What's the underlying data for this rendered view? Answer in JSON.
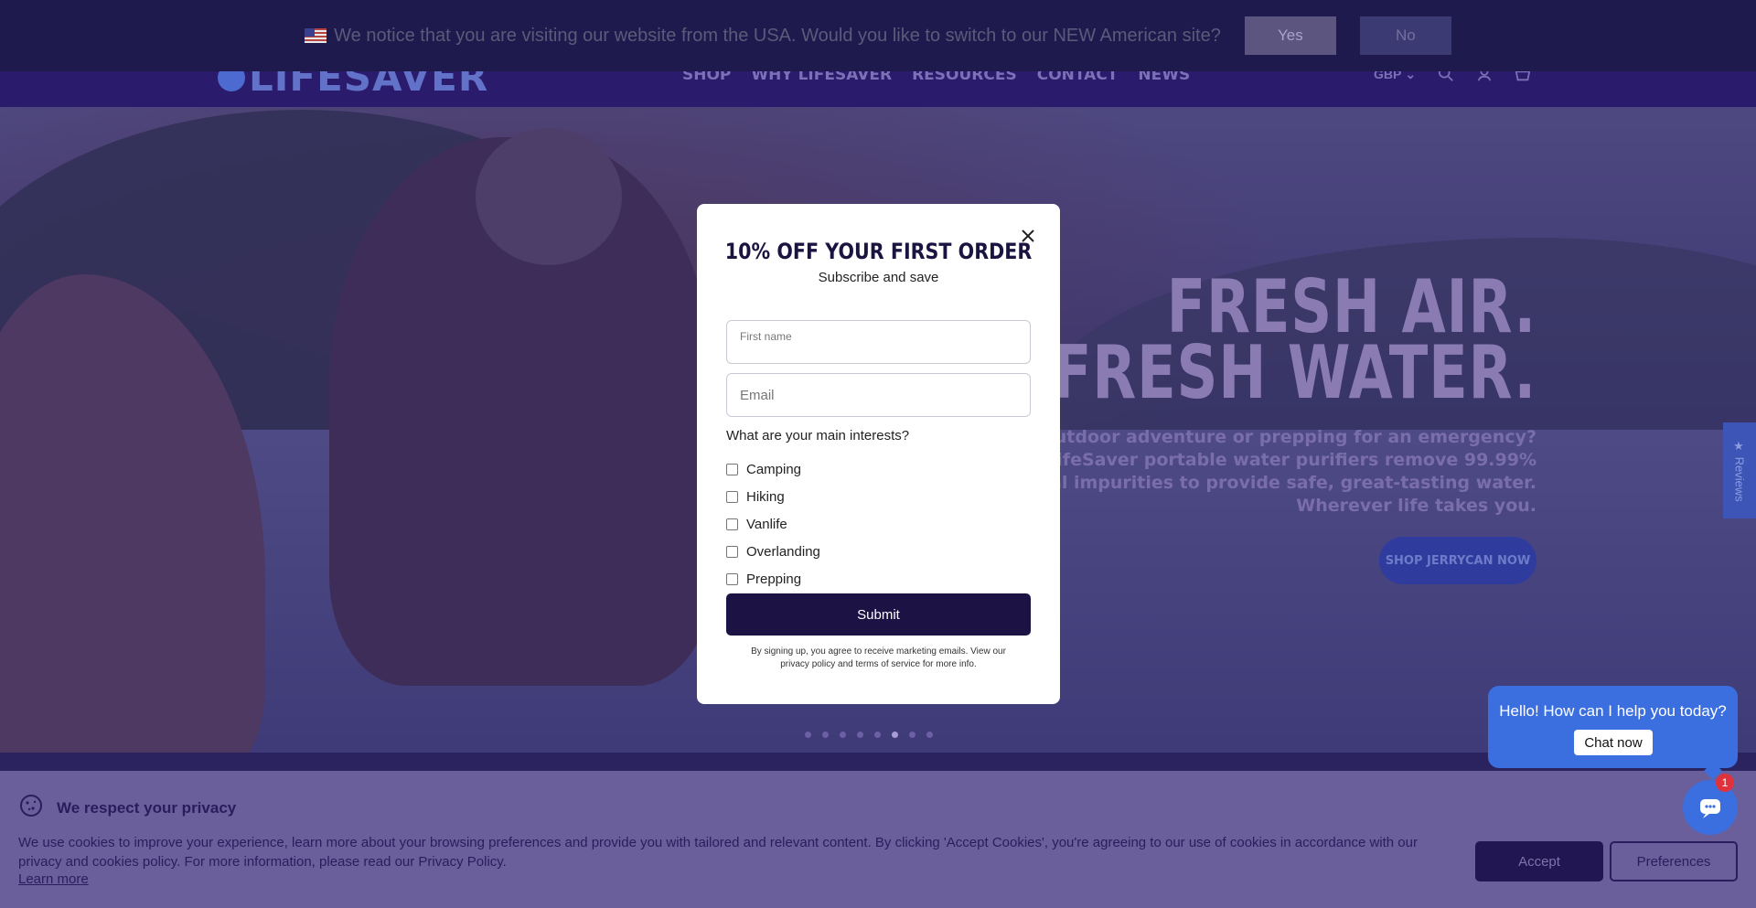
{
  "usa_banner": {
    "message": "We notice that you are visiting our website from the USA. Would you like to switch to our NEW American site?",
    "yes_label": "Yes",
    "no_label": "No",
    "flag_icon": "us-flag-icon"
  },
  "header": {
    "logo_text": "LIFESAVER",
    "nav": [
      "SHOP",
      "WHY LIFESAVER",
      "RESOURCES",
      "CONTACT",
      "NEWS"
    ],
    "currency": "GBP",
    "icons": [
      "search-icon",
      "account-icon",
      "cart-icon"
    ]
  },
  "hero": {
    "title_line1": "FRESH AIR.",
    "title_line2": "FRESH WATER.",
    "description": "Planning an outdoor adventure or prepping for an emergency? LifeSaver portable water purifiers remove 99.99% microbiological impurities to provide safe, great-tasting water. Wherever life takes you.",
    "cta": "SHOP JERRYCAN NOW",
    "slides_total": 8,
    "active_slide": 6
  },
  "reviews_tab": {
    "label": "★ Reviews"
  },
  "modal": {
    "title": "10% OFF YOUR FIRST ORDER",
    "subtitle": "Subscribe and save",
    "first_name_label": "First name",
    "email_placeholder": "Email",
    "interests_question": "What are your main interests?",
    "interests": [
      "Camping",
      "Hiking",
      "Vanlife",
      "Overlanding",
      "Prepping"
    ],
    "submit_label": "Submit",
    "legal": "By signing up, you agree to receive marketing emails. View our privacy policy and terms of service for more info."
  },
  "cookie": {
    "title": "We respect your privacy",
    "text": "We use cookies to improve your experience, learn more about your browsing preferences and provide you with tailored and relevant content. By clicking 'Accept Cookies', you're agreeing to our use of cookies in accordance with our privacy and cookies policy. For more information, please read our Privacy Policy.",
    "learn_more": "Learn more",
    "accept_label": "Accept",
    "preferences_label": "Preferences"
  },
  "chat": {
    "greeting": "Hello! How can I help you today?",
    "chat_now_label": "Chat now",
    "badge_count": "1"
  },
  "colors": {
    "brand_purple": "#2b1b6c",
    "submit_bg": "#1c1244",
    "chat_blue": "#3b6fe0"
  }
}
